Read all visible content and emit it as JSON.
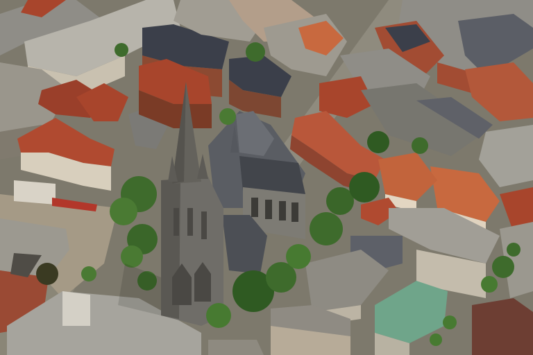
{
  "scene": {
    "description_name": "aerial-oblique-city-view",
    "palette": {
      "street": "#8a8677",
      "street_shadow": "#5e5b50",
      "roof_red": "#a8452c",
      "roof_orange": "#c8693f",
      "roof_dark": "#3b3f4a",
      "roof_slate": "#4a4e58",
      "roof_gray": "#8f8d87",
      "roof_light": "#b7b4ab",
      "wall_brick": "#8c4a32",
      "wall_light": "#c9c1b0",
      "church_stone": "#6f6d68",
      "church_roof": "#5a5d63",
      "tree_green": "#3e6b2c",
      "tree_dark": "#2b4d20",
      "green_roof": "#6fa58a",
      "square_pave": "#a59a86"
    }
  }
}
